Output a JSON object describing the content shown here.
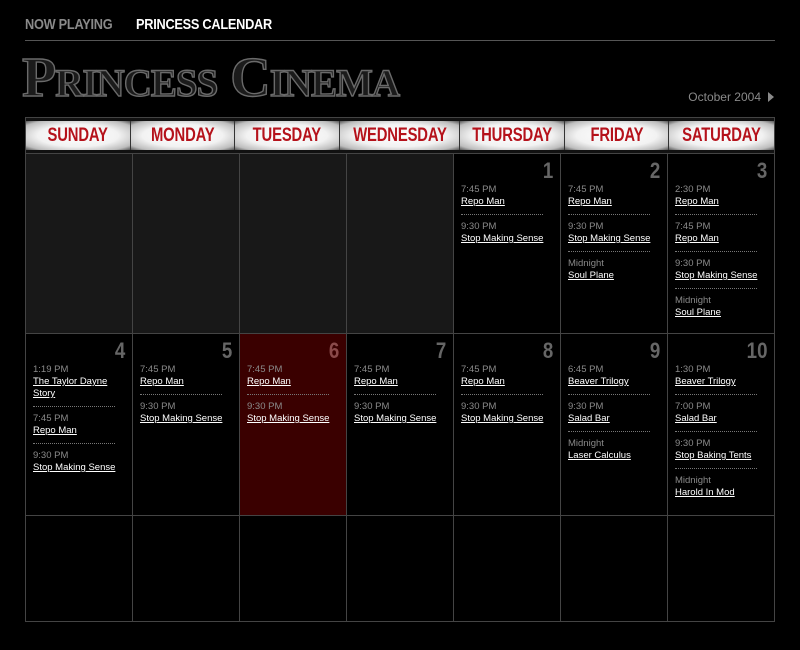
{
  "nav": {
    "now_playing": "NOW PLAYING",
    "calendar": "PRINCESS CALENDAR"
  },
  "logo": "Princess Cinema",
  "month": "October 2004",
  "weekdays": [
    "SUNDAY",
    "MONDAY",
    "TUESDAY",
    "WEDNESDAY",
    "THURSDAY",
    "FRIDAY",
    "SATURDAY"
  ],
  "weeks": [
    [
      {
        "day": "",
        "shows": []
      },
      {
        "day": "",
        "shows": []
      },
      {
        "day": "",
        "shows": []
      },
      {
        "day": "",
        "shows": []
      },
      {
        "day": "1",
        "shows": [
          {
            "time": "7:45 PM",
            "film": "Repo Man"
          },
          {
            "time": "9:30 PM",
            "film": "Stop Making Sense"
          }
        ]
      },
      {
        "day": "2",
        "shows": [
          {
            "time": "7:45 PM",
            "film": "Repo Man"
          },
          {
            "time": "9:30 PM",
            "film": "Stop Making Sense"
          },
          {
            "time": "Midnight",
            "film": "Soul Plane"
          }
        ]
      },
      {
        "day": "3",
        "shows": [
          {
            "time": "2:30 PM",
            "film": "Repo Man"
          },
          {
            "time": "7:45 PM",
            "film": "Repo Man"
          },
          {
            "time": "9:30 PM",
            "film": "Stop Making Sense"
          },
          {
            "time": "Midnight",
            "film": "Soul Plane"
          }
        ]
      }
    ],
    [
      {
        "day": "4",
        "shows": [
          {
            "time": "1:19 PM",
            "film": "The Taylor Dayne Story"
          },
          {
            "time": "7:45 PM",
            "film": "Repo Man"
          },
          {
            "time": "9:30 PM",
            "film": "Stop Making Sense"
          }
        ]
      },
      {
        "day": "5",
        "shows": [
          {
            "time": "7:45 PM",
            "film": "Repo Man"
          },
          {
            "time": "9:30 PM",
            "film": "Stop Making Sense"
          }
        ]
      },
      {
        "day": "6",
        "today": true,
        "shows": [
          {
            "time": "7:45 PM",
            "film": "Repo Man"
          },
          {
            "time": "9:30 PM",
            "film": "Stop Making Sense"
          }
        ]
      },
      {
        "day": "7",
        "shows": [
          {
            "time": "7:45 PM",
            "film": "Repo Man"
          },
          {
            "time": "9:30 PM",
            "film": "Stop Making Sense"
          }
        ]
      },
      {
        "day": "8",
        "shows": [
          {
            "time": "7:45 PM",
            "film": "Repo Man"
          },
          {
            "time": "9:30 PM",
            "film": "Stop Making Sense"
          }
        ]
      },
      {
        "day": "9",
        "shows": [
          {
            "time": "6:45 PM",
            "film": "Beaver Trilogy"
          },
          {
            "time": "9:30 PM",
            "film": "Salad Bar"
          },
          {
            "time": "Midnight",
            "film": "Laser Calculus"
          }
        ]
      },
      {
        "day": "10",
        "shows": [
          {
            "time": "1:30 PM",
            "film": "Beaver Trilogy"
          },
          {
            "time": "7:00 PM",
            "film": "Salad Bar"
          },
          {
            "time": "9:30 PM",
            "film": "Stop Baking Tents"
          },
          {
            "time": "Midnight",
            "film": "Harold In Mod"
          }
        ]
      }
    ],
    [
      {
        "day": "",
        "shows": []
      },
      {
        "day": "",
        "shows": []
      },
      {
        "day": "",
        "shows": []
      },
      {
        "day": "",
        "shows": []
      },
      {
        "day": "",
        "shows": []
      },
      {
        "day": "",
        "shows": []
      },
      {
        "day": "",
        "shows": []
      }
    ]
  ]
}
